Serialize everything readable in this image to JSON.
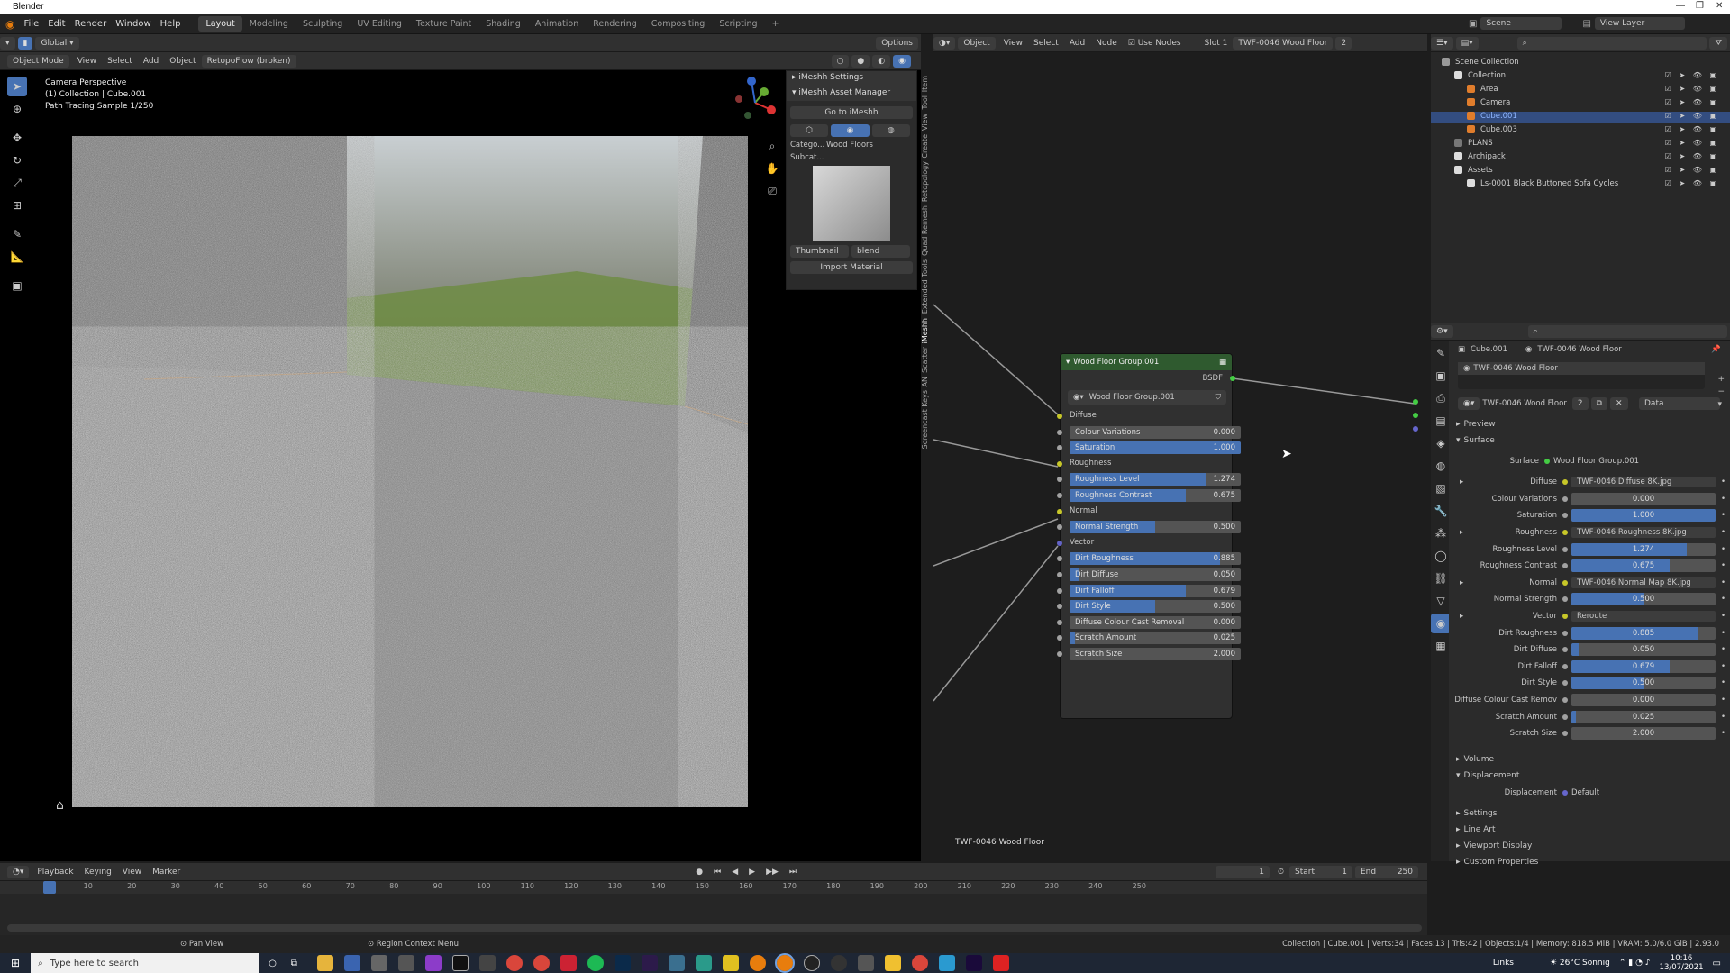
{
  "window": {
    "title": "Blender"
  },
  "menu": {
    "items": [
      "File",
      "Edit",
      "Render",
      "Window",
      "Help"
    ]
  },
  "workspaces": [
    "Layout",
    "Modeling",
    "Sculpting",
    "UV Editing",
    "Texture Paint",
    "Shading",
    "Animation",
    "Rendering",
    "Compositing",
    "Scripting",
    "+"
  ],
  "topright": {
    "scene": "Scene",
    "view_layer": "View Layer"
  },
  "viewport": {
    "mode": "Object Mode",
    "menus": [
      "View",
      "Select",
      "Add",
      "Object"
    ],
    "retopo": "RetopoFlow (broken)",
    "transform": "Global",
    "options": "Options",
    "overlay_lines": [
      "Camera Perspective",
      "(1) Collection | Cube.001",
      "Path Tracing Sample 1/250"
    ]
  },
  "npanel": {
    "sections": [
      "iMeshh Settings",
      "iMeshh Asset Manager"
    ],
    "go_button": "Go to iMeshh",
    "category_label": "Catego...",
    "category_value": "Wood Floors",
    "subcat_label": "Subcat...",
    "thumbnail_label": "Thumbnail",
    "blend_label": "blend",
    "import_button": "Import Material",
    "tabs": [
      "Item",
      "Tool",
      "View",
      "Create",
      "Retopology",
      "Quad Remesh",
      "Extended Tools",
      "iMeshh",
      "Scatter",
      "AN",
      "Screencast Keys"
    ]
  },
  "node_editor": {
    "header": {
      "object": "Object",
      "menus": [
        "View",
        "Select",
        "Add",
        "Node"
      ],
      "use_nodes": "Use Nodes",
      "slot": "Slot 1",
      "material": "TWF-0046 Wood Floor",
      "users": "2"
    },
    "footer_label": "TWF-0046 Wood Floor",
    "node": {
      "title": "Wood Floor Group.001",
      "output": "BSDF",
      "group": "Wood Floor Group.001",
      "inputs": [
        {
          "type": "header",
          "label": "Diffuse",
          "color": "#c7c729"
        },
        {
          "type": "slider",
          "label": "Colour Variations",
          "value": "0.000",
          "fill": 0.0
        },
        {
          "type": "slider",
          "label": "Saturation",
          "value": "1.000",
          "fill": 1.0
        },
        {
          "type": "header",
          "label": "Roughness",
          "color": "#c7c729"
        },
        {
          "type": "slider",
          "label": "Roughness Level",
          "value": "1.274",
          "fill": 0.8
        },
        {
          "type": "slider",
          "label": "Roughness Contrast",
          "value": "0.675",
          "fill": 0.68
        },
        {
          "type": "header",
          "label": "Normal",
          "color": "#c7c729"
        },
        {
          "type": "slider",
          "label": "Normal Strength",
          "value": "0.500",
          "fill": 0.5
        },
        {
          "type": "header",
          "label": "Vector",
          "color": "#6363c7"
        },
        {
          "type": "slider",
          "label": "Dirt Roughness",
          "value": "0.885",
          "fill": 0.88
        },
        {
          "type": "slider",
          "label": "Dirt Diffuse",
          "value": "0.050",
          "fill": 0.05
        },
        {
          "type": "slider",
          "label": "Dirt Falloff",
          "value": "0.679",
          "fill": 0.68
        },
        {
          "type": "slider",
          "label": "Dirt Style",
          "value": "0.500",
          "fill": 0.5
        },
        {
          "type": "slider",
          "label": "Diffuse Colour Cast Removal",
          "value": "0.000",
          "fill": 0.0
        },
        {
          "type": "slider",
          "label": "Scratch Amount",
          "value": "0.025",
          "fill": 0.03
        },
        {
          "type": "slider",
          "label": "Scratch Size",
          "value": "2.000",
          "fill": 0.0
        }
      ]
    }
  },
  "outliner": {
    "items": [
      {
        "label": "Scene Collection",
        "depth": 0,
        "color": "#999"
      },
      {
        "label": "Collection",
        "depth": 1,
        "color": "#ddd"
      },
      {
        "label": "Area",
        "depth": 2,
        "color": "#e07d2c"
      },
      {
        "label": "Camera",
        "depth": 2,
        "color": "#e07d2c"
      },
      {
        "label": "Cube.001",
        "depth": 2,
        "color": "#e07d2c",
        "selected": true
      },
      {
        "label": "Cube.003",
        "depth": 2,
        "color": "#e07d2c"
      },
      {
        "label": "PLANS",
        "depth": 1,
        "color": "#777"
      },
      {
        "label": "Archipack",
        "depth": 1,
        "color": "#ddd"
      },
      {
        "label": "Assets",
        "depth": 1,
        "color": "#ddd"
      },
      {
        "label": "Ls-0001 Black Buttoned Sofa Cycles",
        "depth": 2,
        "color": "#ddd"
      }
    ]
  },
  "properties": {
    "object": "Cube.001",
    "material": "TWF-0046 Wood Floor",
    "slot_item": "TWF-0046 Wood Floor",
    "users": "2",
    "data": "Data",
    "panels": {
      "preview": "Preview",
      "surface": "Surface",
      "volume": "Volume",
      "displacement": "Displacement",
      "settings": "Settings",
      "line_art": "Line Art",
      "viewport_display": "Viewport Display",
      "custom_props": "Custom Properties"
    },
    "surface_label": "Surface",
    "surface_value": "Wood Floor Group.001",
    "rows": [
      {
        "label": "Diffuse",
        "kind": "link",
        "value": "TWF-0046 Diffuse 8K.jpg"
      },
      {
        "label": "Colour Variations",
        "kind": "slider",
        "value": "0.000",
        "fill": 0.0
      },
      {
        "label": "Saturation",
        "kind": "slider",
        "value": "1.000",
        "fill": 1.0
      },
      {
        "label": "Roughness",
        "kind": "link",
        "value": "TWF-0046 Roughness 8K.jpg"
      },
      {
        "label": "Roughness Level",
        "kind": "slider",
        "value": "1.274",
        "fill": 0.8
      },
      {
        "label": "Roughness Contrast",
        "kind": "slider",
        "value": "0.675",
        "fill": 0.68
      },
      {
        "label": "Normal",
        "kind": "link",
        "value": "TWF-0046 Normal Map 8K.jpg"
      },
      {
        "label": "Normal Strength",
        "kind": "slider",
        "value": "0.500",
        "fill": 0.5
      },
      {
        "label": "Vector",
        "kind": "link",
        "value": "Reroute"
      },
      {
        "label": "Dirt Roughness",
        "kind": "slider",
        "value": "0.885",
        "fill": 0.88
      },
      {
        "label": "Dirt Diffuse",
        "kind": "slider",
        "value": "0.050",
        "fill": 0.05
      },
      {
        "label": "Dirt Falloff",
        "kind": "slider",
        "value": "0.679",
        "fill": 0.68
      },
      {
        "label": "Dirt Style",
        "kind": "slider",
        "value": "0.500",
        "fill": 0.5
      },
      {
        "label": "Diffuse Colour Cast Remov",
        "kind": "slider",
        "value": "0.000",
        "fill": 0.0
      },
      {
        "label": "Scratch Amount",
        "kind": "slider",
        "value": "0.025",
        "fill": 0.03
      },
      {
        "label": "Scratch Size",
        "kind": "slider",
        "value": "2.000",
        "fill": 0.0
      }
    ],
    "displacement_label": "Displacement",
    "displacement_value": "Default"
  },
  "timeline": {
    "menus": [
      "Playback",
      "Keying",
      "View",
      "Marker"
    ],
    "current_frame": "1",
    "start_label": "Start",
    "start": "1",
    "end_label": "End",
    "end": "250",
    "ticks": [
      "1",
      "10",
      "20",
      "30",
      "40",
      "50",
      "60",
      "70",
      "80",
      "90",
      "100",
      "110",
      "120",
      "130",
      "140",
      "150",
      "160",
      "170",
      "180",
      "190",
      "200",
      "210",
      "220",
      "230",
      "240",
      "250"
    ]
  },
  "statusbar": {
    "left": "Pan View",
    "mid": "Region Context Menu",
    "right": "Collection | Cube.001 | Verts:34 | Faces:13 | Tris:42 | Objects:1/4 | Memory: 818.5 MiB | VRAM: 5.0/6.0 GiB | 2.93.0"
  },
  "taskbar": {
    "search": "Type here to search",
    "links": "Links",
    "weather": "26°C Sonnig",
    "time": "10:16",
    "date": "13/07/2021"
  }
}
